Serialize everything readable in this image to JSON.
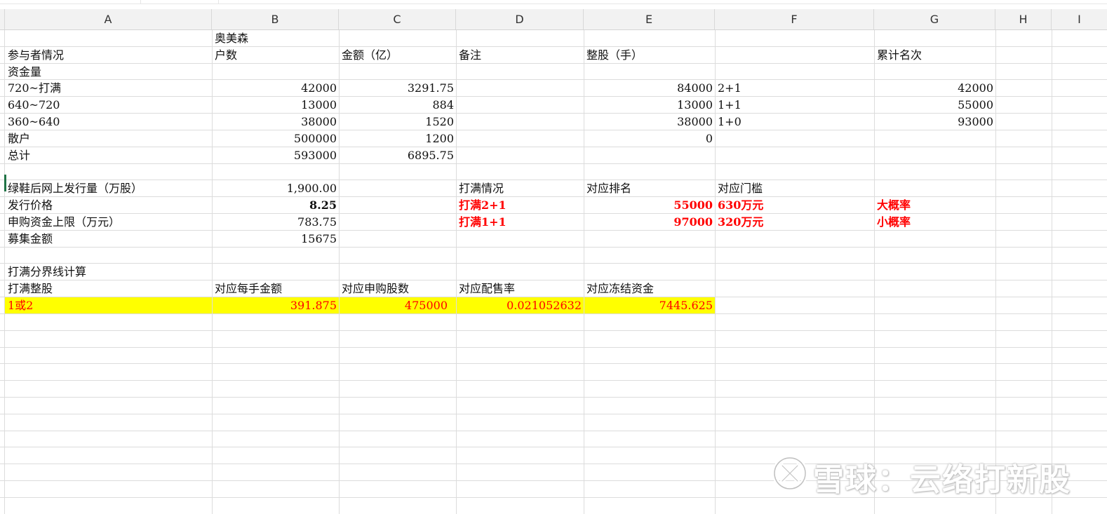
{
  "columns": [
    "A",
    "B",
    "C",
    "D",
    "E",
    "F",
    "G",
    "H",
    "I"
  ],
  "rows": [
    {
      "A": "",
      "B": "奥美森"
    },
    {
      "A": "参与者情况",
      "B": "户数",
      "C": "金额（亿）",
      "D": "备注",
      "E": "整股（手）",
      "G": "累计名次"
    },
    {
      "A": "资金量"
    },
    {
      "A": "720~打满",
      "B": "42000",
      "C": "3291.75",
      "E": "84000",
      "F": "2+1",
      "G": "42000"
    },
    {
      "A": "640~720",
      "B": "13000",
      "C": "884",
      "E": "13000",
      "F": "1+1",
      "G": "55000"
    },
    {
      "A": "360~640",
      "B": "38000",
      "C": "1520",
      "E": "38000",
      "F": "1+0",
      "G": "93000"
    },
    {
      "A": "散户",
      "B": "500000",
      "C": "1200",
      "E": "0"
    },
    {
      "A": "总计",
      "B": "593000",
      "C": "6895.75"
    },
    {},
    {
      "A": "绿鞋后网上发行量（万股）",
      "B": "1,900.00",
      "D": "打满情况",
      "E": "对应排名",
      "F": "对应门槛"
    },
    {
      "A": "发行价格",
      "B": "8.25",
      "D": "打满2+1",
      "E": "55000",
      "F": "630万元",
      "G": "大概率"
    },
    {
      "A": "申购资金上限（万元）",
      "B": "783.75",
      "D": "打满1+1",
      "E": "97000",
      "F": "320万元",
      "G": "小概率"
    },
    {
      "A": "募集金额",
      "B": "15675"
    },
    {},
    {
      "A": "打满分界线计算"
    },
    {
      "A": "打满整股",
      "B": "对应每手金额",
      "C": "对应申购股数",
      "D": "对应配售率",
      "E": "对应冻结资金"
    },
    {
      "A": "1或2",
      "B": "391.875",
      "C": "475000",
      "D": "0.021052632",
      "E": "7445.625"
    }
  ],
  "styles": {
    "highlight_color": "#ffff00",
    "accent_red": "#ff0000",
    "selection_color": "#217346"
  },
  "watermark": {
    "text": "雪球：云络打新股",
    "icon": "xueqiu-logo-icon"
  }
}
